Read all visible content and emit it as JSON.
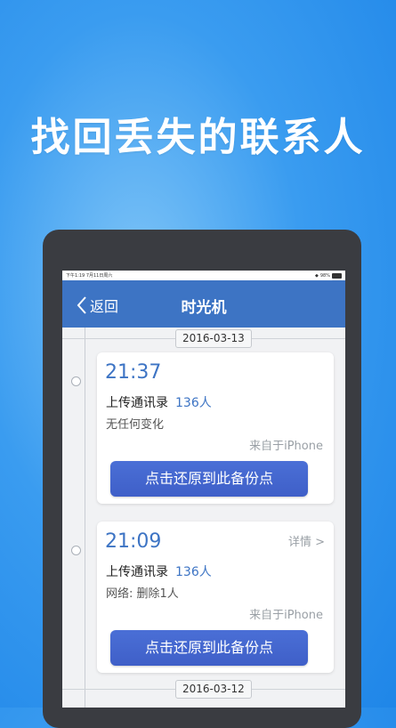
{
  "headline": "找回丢失的联系人",
  "status_bar": {
    "time_date": "下午1:19 7月11日周六",
    "battery": "98%"
  },
  "nav": {
    "back_label": "返回",
    "title": "时光机"
  },
  "dates": {
    "first": "2016-03-13",
    "second": "2016-03-12"
  },
  "records": [
    {
      "time": "21:37",
      "upload_label": "上传通讯录",
      "upload_count": "136人",
      "change": "无任何变化",
      "source": "来自于iPhone",
      "restore_label": "点击还原到此备份点",
      "detail_label": ""
    },
    {
      "time": "21:09",
      "upload_label": "上传通讯录",
      "upload_count": "136人",
      "change": "网络: 删除1人",
      "source": "来自于iPhone",
      "restore_label": "点击还原到此备份点",
      "detail_label": "详情 >"
    }
  ],
  "colors": {
    "nav": "#3d74c4",
    "accent": "#3d74c4",
    "button": "#4263cc",
    "background": "#3a9cf0"
  }
}
